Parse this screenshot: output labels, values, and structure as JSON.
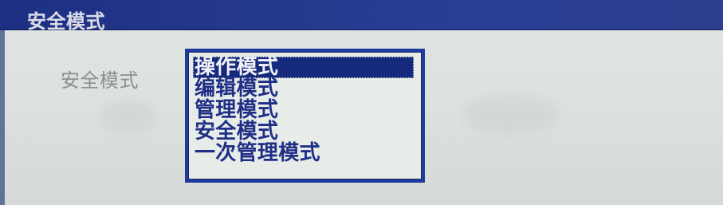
{
  "window": {
    "title": "安全模式"
  },
  "form": {
    "label": "安全模式",
    "options": [
      "操作模式",
      "编辑模式",
      "管理模式",
      "安全模式",
      "一次管理模式"
    ],
    "selected_index": 0
  },
  "colors": {
    "title_bar": "#24388d",
    "list_border": "#1f3aa0",
    "selected_bg": "#152a7c",
    "text_blue": "#1f2f86",
    "label_gray": "#8b8f8f"
  }
}
